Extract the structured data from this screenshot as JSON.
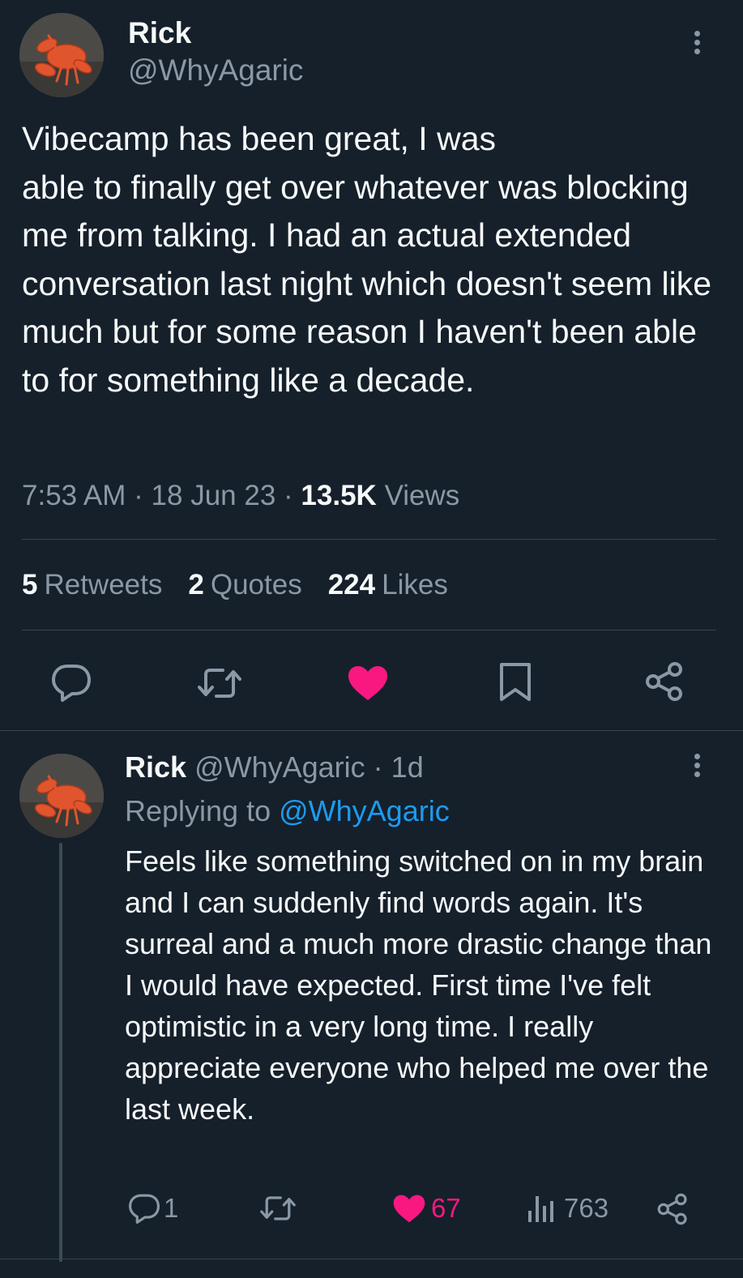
{
  "tweet": {
    "author_name": "Rick",
    "author_handle": "@WhyAgaric",
    "text": "Vibecamp has been great, I was\nable to finally get over whatever was blocking me from talking. I had an actual extended conversation last night which doesn't seem like much but for some reason I haven't been able to for something like a decade.",
    "time": "7:53 AM",
    "date": "18 Jun 23",
    "views_count": "13.5K",
    "views_label": "Views",
    "retweets_count": "5",
    "retweets_label": "Retweets",
    "quotes_count": "2",
    "quotes_label": "Quotes",
    "likes_count": "224",
    "likes_label": "Likes"
  },
  "reply": {
    "author_name": "Rick",
    "author_handle": "@WhyAgaric",
    "age": "1d",
    "replying_label": "Replying to",
    "replying_handle": "@WhyAgaric",
    "text": "Feels like something switched on in my brain and I can suddenly find words again. It's surreal and a much more drastic change than I would have expected. First time I've felt optimistic in a very long time. I really appreciate everyone who helped me over the last week.",
    "reply_count": "1",
    "like_count": "67",
    "views_count": "763"
  },
  "icons": [
    "more-icon",
    "reply-icon",
    "retweet-icon",
    "heart-icon",
    "bookmark-icon",
    "share-icon",
    "views-icon"
  ],
  "colors": {
    "background": "#15202b",
    "text": "#f7f9f9",
    "secondary": "#8b98a5",
    "link": "#1d9bf0",
    "like": "#f91880",
    "divider": "#38444d"
  }
}
